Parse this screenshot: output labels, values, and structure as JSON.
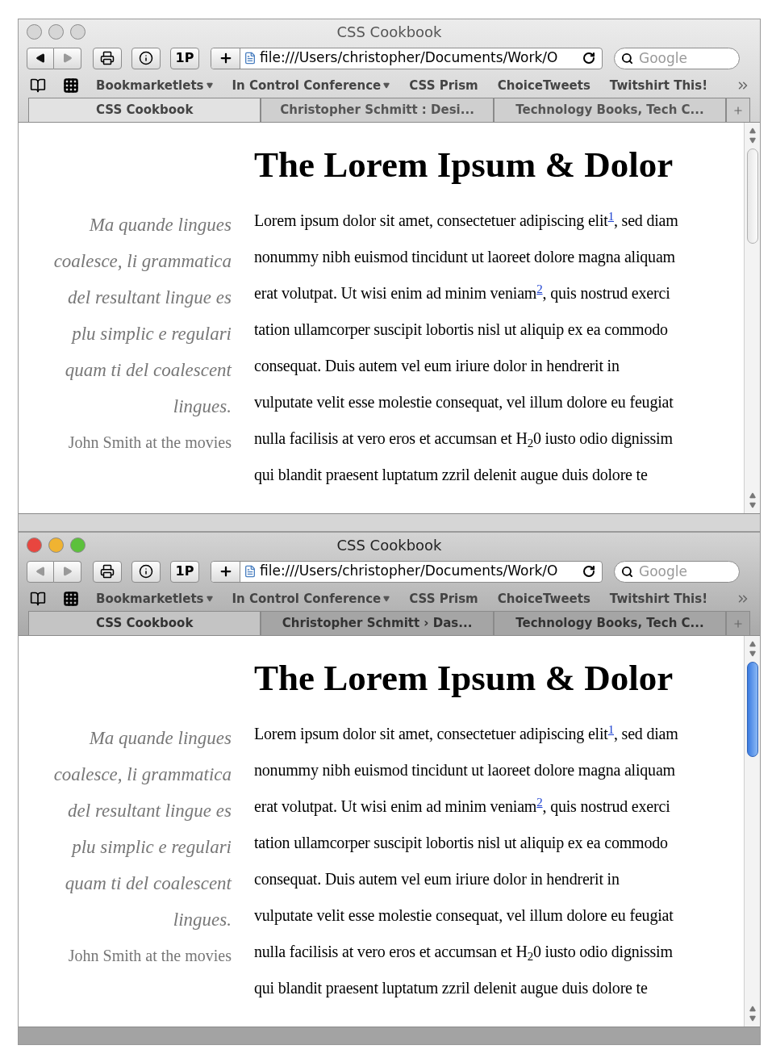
{
  "windows": [
    {
      "active": false,
      "title": "CSS Cookbook",
      "url": "file:///Users/christopher/Documents/Work/O",
      "search": {
        "placeholder": "Google"
      },
      "toolbar_buttons": [
        {
          "label": "1P"
        }
      ],
      "bookmarks": [
        {
          "label": "Bookmarketlets",
          "menu": true
        },
        {
          "label": "In Control Conference",
          "menu": true
        },
        {
          "label": "CSS Prism",
          "menu": false
        },
        {
          "label": "ChoiceTweets",
          "menu": false
        },
        {
          "label": "Twitshirt This!",
          "menu": false
        }
      ],
      "tabs": [
        {
          "label": "CSS Cookbook",
          "selected": true
        },
        {
          "label": "Christopher Schmitt : Desi...",
          "selected": false
        },
        {
          "label": "Technology Books, Tech C...",
          "selected": false
        }
      ],
      "page": {
        "heading": "The Lorem Ipsum & Dolor",
        "quote_lines": [
          "Ma quande lingues",
          "coalesce, li grammatica",
          "del resultant lingue es",
          "plu simplic e regulari",
          "quam ti del coalescent",
          "lingues."
        ],
        "attribution": "John Smith at the movies",
        "body_lines": [
          "Lorem ipsum dolor sit amet, consectetuer adipiscing elit$^{1}$, sed diam",
          "nonummy nibh euismod tincidunt ut laoreet dolore magna aliquam",
          "erat volutpat. Ut wisi enim ad minim veniam$^{2}$, quis nostrud exerci",
          "tation ullamcorper suscipit lobortis nisl ut aliquip ex ea commodo",
          "consequat. Duis autem vel eum iriure dolor in hendrerit in",
          "vulputate velit esse molestie consequat, vel illum dolore eu feugiat",
          "nulla facilisis at vero eros et accumsan et H$_{2}$0 iusto odio dignissim",
          "qui blandit praesent luptatum zzril delenit augue duis dolore te"
        ]
      }
    },
    {
      "active": true,
      "title": "CSS Cookbook",
      "url": "file:///Users/christopher/Documents/Work/O",
      "search": {
        "placeholder": "Google"
      },
      "toolbar_buttons": [
        {
          "label": "1P"
        }
      ],
      "bookmarks": [
        {
          "label": "Bookmarketlets",
          "menu": true
        },
        {
          "label": "In Control Conference",
          "menu": true
        },
        {
          "label": "CSS Prism",
          "menu": false
        },
        {
          "label": "ChoiceTweets",
          "menu": false
        },
        {
          "label": "Twitshirt This!",
          "menu": false
        }
      ],
      "tabs": [
        {
          "label": "CSS Cookbook",
          "selected": true
        },
        {
          "label": "Christopher Schmitt › Das...",
          "selected": false
        },
        {
          "label": "Technology Books, Tech C...",
          "selected": false
        }
      ],
      "page": {
        "heading": "The Lorem Ipsum & Dolor",
        "quote_lines": [
          "Ma quande lingues",
          "coalesce, li grammatica",
          "del resultant lingue es",
          "plu simplic e regulari",
          "quam ti del coalescent",
          "lingues."
        ],
        "attribution": "John Smith at the movies",
        "body_lines": [
          "Lorem ipsum dolor sit amet, consectetuer adipiscing elit$^{1}$, sed diam",
          "nonummy nibh euismod tincidunt ut laoreet dolore magna aliquam",
          "erat volutpat. Ut wisi enim ad minim veniam$^{2}$, quis nostrud exerci",
          "tation ullamcorper suscipit lobortis nisl ut aliquip ex ea commodo",
          "consequat. Duis autem vel eum iriure dolor in hendrerit in",
          "vulputate velit esse molestie consequat, vel illum dolore eu feugiat",
          "nulla facilisis at vero eros et accumsan et H$_{2}$0 iusto odio dignissim",
          "qui blandit praesent luptatum zzril delenit augue duis dolore te"
        ]
      }
    }
  ]
}
